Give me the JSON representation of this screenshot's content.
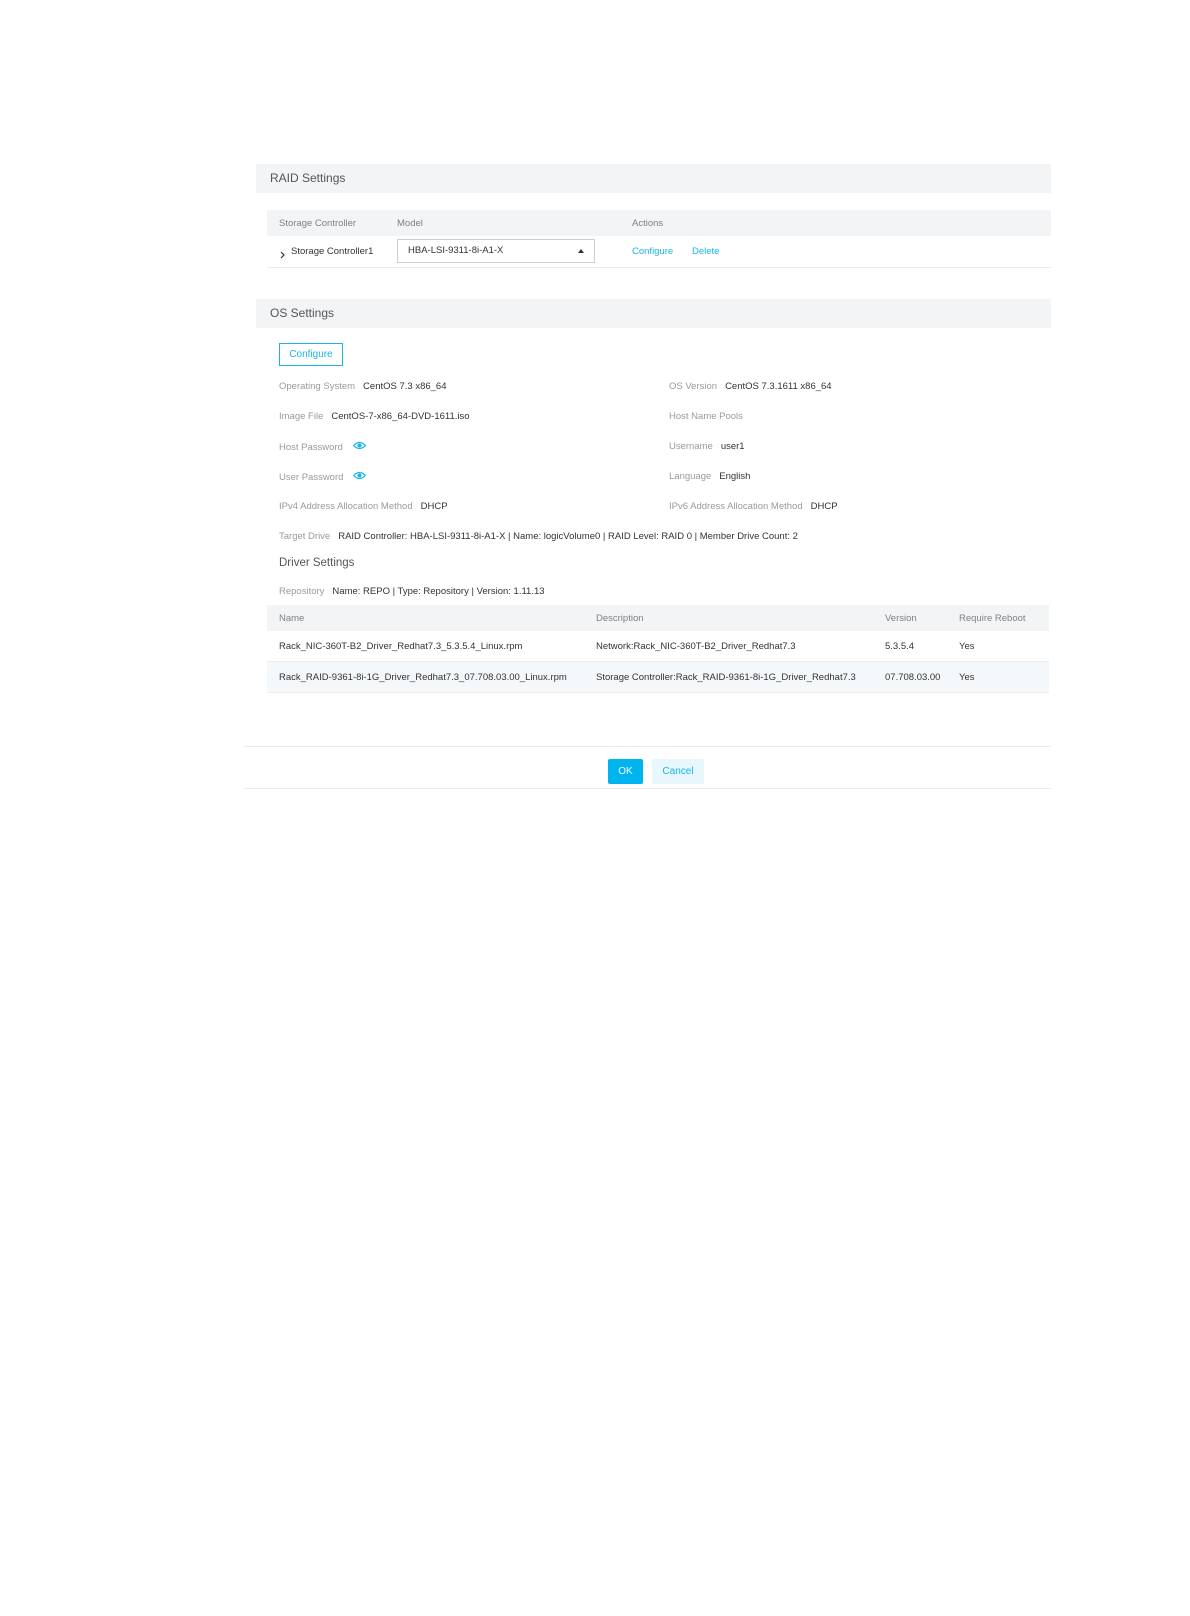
{
  "raid": {
    "title": "RAID Settings",
    "columns": [
      "Storage Controller",
      "Model",
      "Actions"
    ],
    "row": {
      "expand_icon": "chevron-right-icon",
      "controller": "Storage Controller1",
      "model": "HBA-LSI-9311-8i-A1-X",
      "actions": [
        "Configure",
        "Delete"
      ]
    }
  },
  "os": {
    "title": "OS Settings",
    "configure_label": "Configure",
    "fields": {
      "operating_system": {
        "label": "Operating System",
        "value": "CentOS 7.3 x86_64"
      },
      "os_version": {
        "label": "OS Version",
        "value": "CentOS 7.3.1611 x86_64"
      },
      "image_file": {
        "label": "Image File",
        "value": "CentOS-7-x86_64-DVD-1611.iso"
      },
      "host_name_pools": {
        "label": "Host Name Pools",
        "value": ""
      },
      "host_password": {
        "label": "Host Password",
        "icon": "eye-icon"
      },
      "username": {
        "label": "Username",
        "value": "user1"
      },
      "user_password": {
        "label": "User Password",
        "icon": "eye-icon"
      },
      "language": {
        "label": "Language",
        "value": "English"
      },
      "ipv4": {
        "label": "IPv4 Address Allocation Method",
        "value": "DHCP"
      },
      "ipv6": {
        "label": "IPv6 Address Allocation Method",
        "value": "DHCP"
      },
      "target_drive": {
        "label": "Target Drive",
        "value": "RAID Controller: HBA-LSI-9311-8i-A1-X | Name: logicVolume0 | RAID Level: RAID 0 | Member Drive Count: 2"
      }
    }
  },
  "driver": {
    "title": "Driver Settings",
    "repository": {
      "label": "Repository",
      "value": "Name: REPO | Type: Repository | Version: 1.11.13"
    },
    "columns": [
      "Name",
      "Description",
      "Version",
      "Require Reboot"
    ],
    "rows": [
      [
        "Rack_NIC-360T-B2_Driver_Redhat7.3_5.3.5.4_Linux.rpm",
        "Network:Rack_NIC-360T-B2_Driver_Redhat7.3",
        "5.3.5.4",
        "Yes"
      ],
      [
        "Rack_RAID-9361-8i-1G_Driver_Redhat7.3_07.708.03.00_Linux.rpm",
        "Storage Controller:Rack_RAID-9361-8i-1G_Driver_Redhat7.3",
        "07.708.03.00",
        "Yes"
      ]
    ]
  },
  "footer": {
    "ok_label": "OK",
    "cancel_label": "Cancel"
  },
  "colors": {
    "accent": "#16b6e8",
    "primary_button": "#00b4ef",
    "header_bg": "#f3f4f6"
  }
}
